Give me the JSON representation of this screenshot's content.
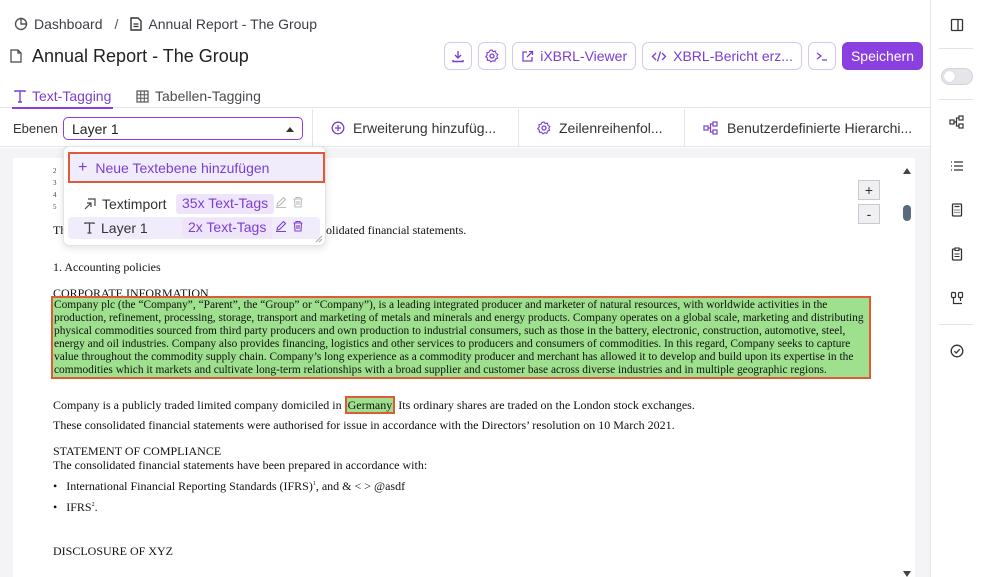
{
  "breadcrumb": {
    "root": "Dashboard",
    "separator": "/",
    "current": "Annual Report - The Group"
  },
  "header": {
    "title": "Annual Report - The Group"
  },
  "toolbar": {
    "ixbrl_viewer": "iXBRL-Viewer",
    "xbrl_report": "XBRL-Bericht erz...",
    "save": "Speichern"
  },
  "tabs": [
    {
      "label": "Text-Tagging",
      "active": true
    },
    {
      "label": "Tabellen-Tagging",
      "active": false
    }
  ],
  "layerbar": {
    "label": "Ebenen",
    "selected_layer": "Layer 1",
    "items": [
      {
        "label": "Erweiterung hinzufüg..."
      },
      {
        "label": "Zeilenreihenfol..."
      },
      {
        "label": "Benutzerdefinierte Hierarchi..."
      }
    ]
  },
  "dropdown": {
    "add_label": "Neue Textebene hinzufügen",
    "layers": [
      {
        "name": "Textimport",
        "tags": "35x Text-Tags",
        "selected": false
      },
      {
        "name": "Layer 1",
        "tags": "2x Text-Tags",
        "selected": true
      }
    ]
  },
  "zoom": {
    "plus": "+",
    "minus": "-"
  },
  "document": {
    "line_numbers": [
      "2",
      "3",
      "4",
      "5"
    ],
    "intro_start": "Th",
    "intro_end": "olidated financial statements.",
    "heading_policies": "1. Accounting policies",
    "heading_corporate": "CORPORATE INFORMATION",
    "corporate_para": "Company plc (the “Company”, “Parent”, the “Group” or “Company”), is a leading integrated producer and marketer of natural resources, with worldwide activities in the production, refinement, processing, storage, transport and marketing of metals and minerals and energy products. Company operates on a global scale, marketing and distributing physical commodities sourced from third party producers and own production to industrial consumers, such as those in the battery, electronic, construction, automotive, steel, energy and oil industries. Company also provides financing, logistics and other services to producers and consumers of commodities. In this regard, Company seeks to capture value throughout the commodity supply chain. Company’s long experience as a commodity producer and merchant has allowed it to develop and build upon its expertise in the commodities which it markets and cultivate long-term relationships with a broad supplier and customer base across diverse industries and in multiple geographic regions.",
    "domicile_pre": "Company is a publicly traded limited company domiciled in ",
    "domicile_country": "Germany",
    "domicile_post": " Its ordinary shares are traded on the London stock exchanges.",
    "authorised": "These consolidated financial statements were authorised for issue in accordance with the Directors’ resolution on 10 March 2021.",
    "heading_compliance": "STATEMENT OF COMPLIANCE",
    "compliance_intro": "The consolidated financial statements have been prepared in accordance with:",
    "bullet_1": "International Financial Reporting Standards (IFRS)",
    "bullet_1_sup": "1",
    "bullet_1_post": ", and & < > @asdf",
    "bullet_2": "IFRS",
    "bullet_2_sup": "2",
    "bullet_2_post": ".",
    "heading_disclosure": "DISCLOSURE OF XYZ"
  },
  "colors": {
    "accent": "#8a3fe0",
    "highlight": "#9ee08d",
    "highlight_border": "#e05a36"
  }
}
